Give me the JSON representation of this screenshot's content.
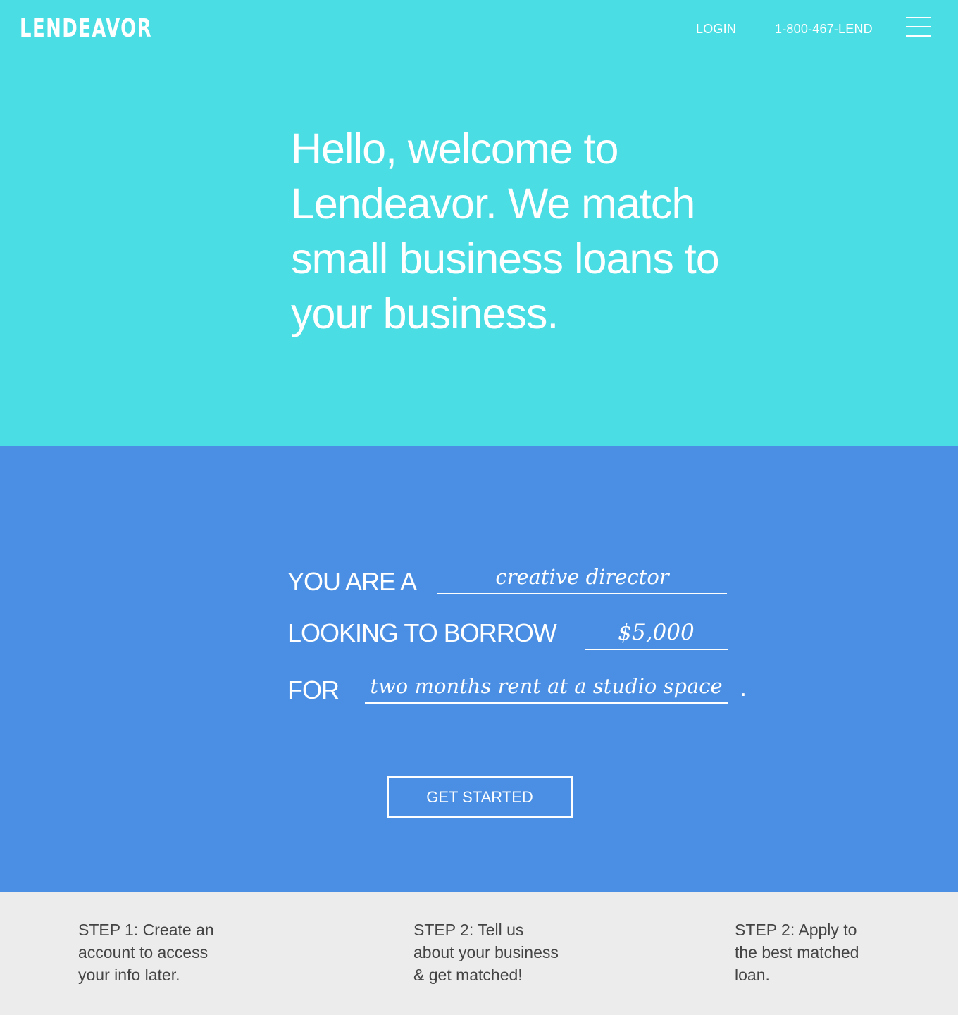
{
  "header": {
    "logo": "LENDEAVOR",
    "login_label": "LOGIN",
    "phone_label": "1-800-467-LEND",
    "menu_icon": "hamburger-menu-icon"
  },
  "hero": {
    "headline": "Hello, welcome to Lendeavor. We match small business loans to your business."
  },
  "form": {
    "role_label": "YOU ARE A",
    "role_value": "creative director",
    "amount_label": "LOOKING TO BORROW",
    "amount_value": "$5,000",
    "purpose_label": "FOR",
    "purpose_value": "two months rent at a studio space",
    "period": ".",
    "cta_label": "GET STARTED"
  },
  "steps": [
    {
      "text": "STEP 1: Create an\naccount to access\nyour info later."
    },
    {
      "text": "STEP 2: Tell us\nabout your business\n& get matched!"
    },
    {
      "text": "STEP 2: Apply to\nthe best matched\nloan."
    }
  ],
  "colors": {
    "hero_bg": "#4adde3",
    "form_bg": "#4a8fe3",
    "steps_bg": "#ececec",
    "steps_text": "#444444",
    "text_on_color": "#ffffff"
  }
}
